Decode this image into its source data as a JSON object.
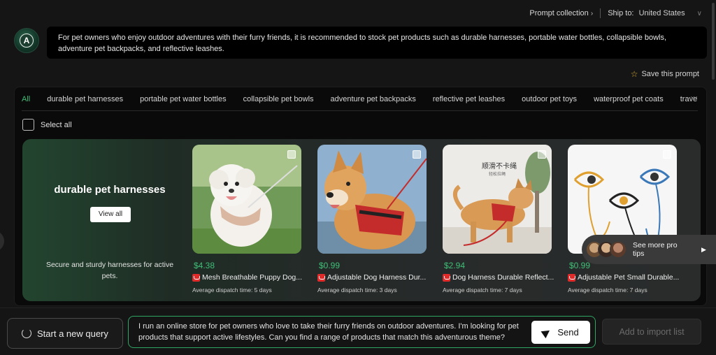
{
  "topbar": {
    "prompt_collection": "Prompt collection",
    "ship_to_label": "Ship to:",
    "country": "United States"
  },
  "prompt": {
    "text": "For pet owners who enjoy outdoor adventures with their furry friends, it is recommended to stock pet products such as durable harnesses, portable water bottles, collapsible bowls, adventure pet backpacks, and reflective leashes."
  },
  "save_prompt_label": "Save this prompt",
  "tabs": [
    "All",
    "durable pet harnesses",
    "portable pet water bottles",
    "collapsible pet bowls",
    "adventure pet backpacks",
    "reflective pet leashes",
    "outdoor pet toys",
    "waterproof pet coats",
    "travel"
  ],
  "tabs_more": "···",
  "select_all_label": "Select all",
  "category": {
    "title": "durable pet harnesses",
    "view_all": "View all",
    "description": "Secure and sturdy harnesses for active pets."
  },
  "products": [
    {
      "price": "$4.38",
      "title": "Mesh Breathable Puppy Dog...",
      "dispatch": "Average dispatch time: 5 days"
    },
    {
      "price": "$0.99",
      "title": "Adjustable Dog Harness Dur...",
      "dispatch": "Average dispatch time: 3 days"
    },
    {
      "price": "$2.94",
      "title": "Dog Harness Durable Reflect...",
      "dispatch": "Average dispatch time: 7 days",
      "image_caption": "顺滑不卡绳",
      "image_subcaption": "轻松拉绳"
    },
    {
      "price": "$0.99",
      "title": "Adjustable Pet Small Durable...",
      "dispatch": "Average dispatch time: 7 days"
    }
  ],
  "pro_tips": {
    "label": "See more pro tips"
  },
  "bottom": {
    "new_query": "Start a new query",
    "query_text": "I run an online store for pet owners who love to take their furry friends on outdoor adventures. I'm looking for pet products that support active lifestyles. Can you find a range of products that match this adventurous theme?",
    "send": "Send",
    "add_to_import": "Add to import list"
  },
  "colors": {
    "accent": "#3fbf77",
    "store_badge": "#e02b2b"
  }
}
